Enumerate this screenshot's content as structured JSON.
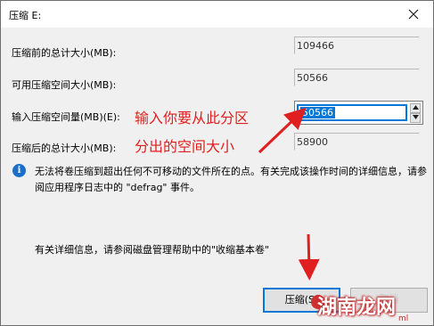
{
  "window": {
    "title": "压缩 E:",
    "close_glyph": "✕"
  },
  "rows": {
    "total_before_label": "压缩前的总计大小(MB):",
    "total_before_value": "109466",
    "available_label": "可用压缩空间大小(MB):",
    "available_value": "50566",
    "input_label": "输入压缩空间量(MB)(E):",
    "input_value": "50566",
    "total_after_label": "压缩后的总计大小(MB):",
    "total_after_value": "58900"
  },
  "annotations": {
    "line1": "输入你要从此分区",
    "line2": "分出的空间大小",
    "color": "#e02020"
  },
  "info": {
    "icon": "info-icon",
    "text": "无法将卷压缩到超出任何不可移动的文件所在的点。有关完成该操作时间的详细信息，请参阅应用程序日志中的 \"defrag\" 事件。"
  },
  "help": {
    "text": "有关详细信息，请参阅磁盘管理帮助中的\"收缩基本卷\""
  },
  "buttons": {
    "shrink_label": "压缩(S)",
    "cancel_label": "取消"
  },
  "watermark": {
    "text": "湖南龙网",
    "sub": "ml"
  },
  "colors": {
    "accent": "#0078d7",
    "annotation": "#e02020"
  }
}
